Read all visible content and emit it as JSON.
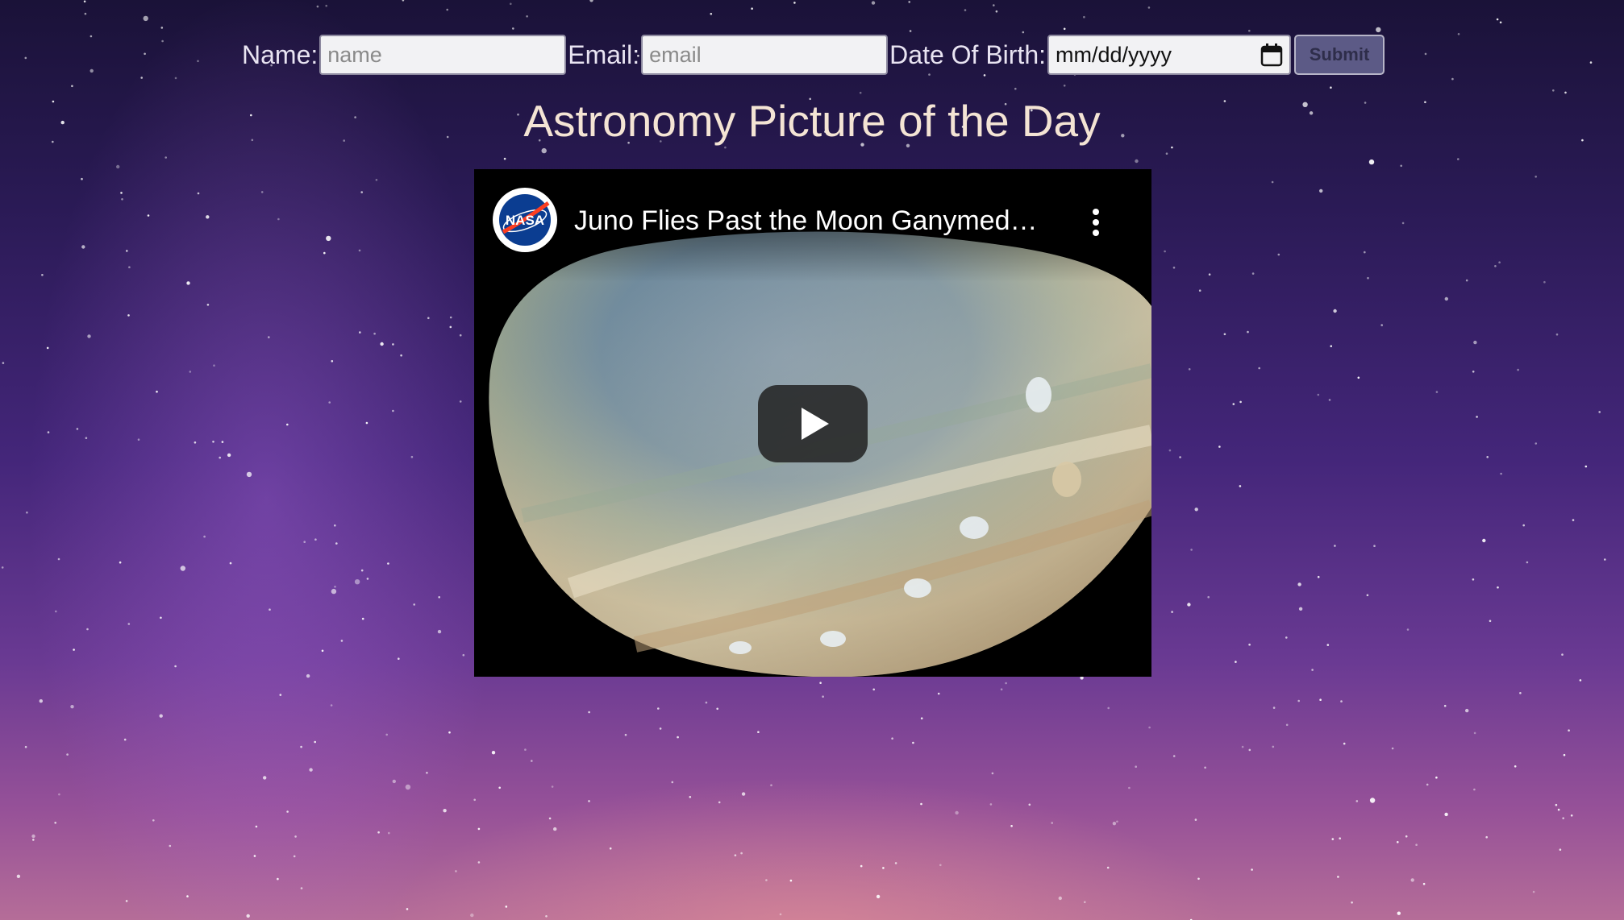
{
  "form": {
    "name_label": "Name:",
    "name_placeholder": "name",
    "email_label": "Email:",
    "email_placeholder": "email",
    "dob_label": "Date Of Birth:",
    "dob_placeholder": "mm/dd/yyyy",
    "submit_label": "Submit"
  },
  "page": {
    "title": "Astronomy Picture of the Day"
  },
  "video": {
    "title": "Juno Flies Past the Moon Ganymed…",
    "channel_logo_text": "NASA",
    "icons": {
      "channel": "nasa-logo",
      "menu": "more-vertical-icon",
      "play": "play-button-icon",
      "calendar": "calendar-icon"
    }
  },
  "colors": {
    "title": "#f4e4d4",
    "labels": "#e9e4f2",
    "submit_bg": "#5c5a86",
    "youtube_play_bg": "#212121"
  }
}
